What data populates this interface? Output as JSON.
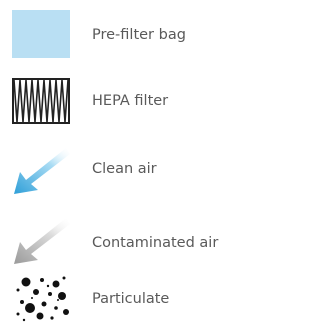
{
  "legend": {
    "items": [
      {
        "icon": "pre-filter-bag-swatch",
        "color": "#b9dff3",
        "label": "Pre-filter bag"
      },
      {
        "icon": "hepa-filter-zigzag",
        "color": "#222222",
        "label": "HEPA filter"
      },
      {
        "icon": "clean-air-arrow",
        "color": "#39a9de",
        "label": "Clean air"
      },
      {
        "icon": "contaminated-air-arrow",
        "color": "#a9a9a9",
        "label": "Contaminated air"
      },
      {
        "icon": "particulate-dots",
        "color": "#111111",
        "label": "Particulate"
      }
    ]
  }
}
